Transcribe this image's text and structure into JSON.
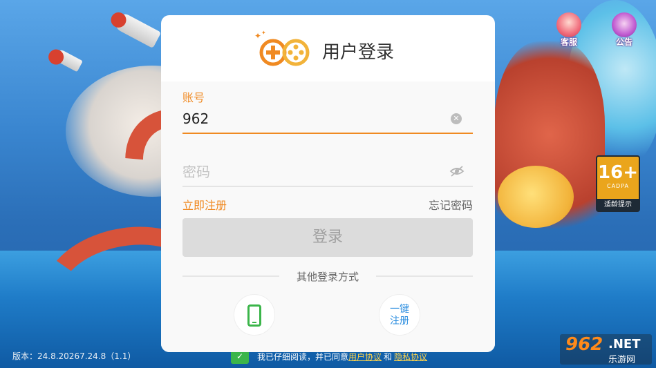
{
  "top_icons": {
    "service_label": "客服",
    "notice_label": "公告"
  },
  "age_rating": {
    "age": "16+",
    "org": "CADPA",
    "tip": "适龄提示"
  },
  "footer": {
    "version": "版本：24.8.20267.24.8（1.1）",
    "agree_prefix": "我已仔细阅读，并已同意",
    "user_agreement": "用户协议",
    "and": "和",
    "privacy_policy": "隐私协议"
  },
  "watermark": {
    "brand_num": "962",
    "brand_net": ".NET",
    "brand_cn": "乐游网"
  },
  "dialog": {
    "title": "用户登录",
    "account_label": "账号",
    "account_value": "962",
    "password_placeholder": "密码",
    "register_link": "立即注册",
    "forgot_link": "忘记密码",
    "login_button": "登录",
    "other_methods": "其他登录方式",
    "quick_register_line1": "一键",
    "quick_register_line2": "注册"
  },
  "colors": {
    "accent": "#f08a22",
    "green": "#3bb54a",
    "link_blue": "#2e8fe0"
  }
}
